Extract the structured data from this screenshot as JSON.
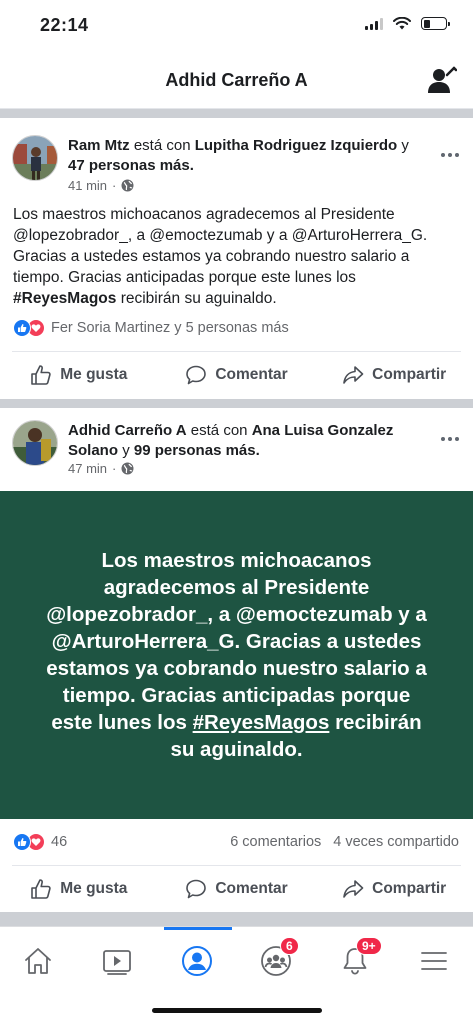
{
  "status_bar": {
    "time": "22:14"
  },
  "header": {
    "title": "Adhid Carreño A",
    "icon": "add-friend-icon"
  },
  "posts": [
    {
      "author": "Ram Mtz",
      "with_text": "está con",
      "tagged": "Lupitha Rodriguez Izquierdo",
      "and_text": "y",
      "others": "47 personas más",
      "time": "41 min",
      "privacy_icon": "globe-icon",
      "text_main": "Los maestros michoacanos agradecemos al Presidente @lopezobrador_, a @emoctezumab y a @ArturoHerrera_G. Gracias a ustedes estamos ya cobrando nuestro salario a tiempo. Gracias anticipadas porque este lunes los",
      "hashtag": "#ReyesMagos",
      "text_end": "recibirán su aguinaldo.",
      "reactions_text": "Fer Soria Martinez y 5 personas más"
    },
    {
      "author": "Adhid Carreño A",
      "with_text": "está con",
      "tagged": "Ana Luisa Gonzalez Solano",
      "and_text": "y",
      "others": "99 personas más",
      "time": "47 min",
      "privacy_icon": "globe-icon",
      "card_main": "Los maestros michoacanos agradecemos al Presidente @lopezobrador_, a @emoctezumab y a @ArturoHerrera_G. Gracias a ustedes estamos ya cobrando nuestro salario a tiempo. Gracias anticipadas porque este lunes los",
      "hashtag": "#ReyesMagos",
      "card_end": "recibirán su aguinaldo.",
      "card_color": "#1e5442",
      "reaction_count": "46",
      "comments": "6 comentarios",
      "shares": "4 veces compartido"
    }
  ],
  "actions": {
    "like": "Me gusta",
    "comment": "Comentar",
    "share": "Compartir"
  },
  "bottom_nav": {
    "groups_badge": "6",
    "notifications_badge": "9+"
  },
  "colors": {
    "accent": "#1877f2",
    "like": "#1877f2",
    "love": "#f33e58",
    "badge": "#f02849"
  }
}
